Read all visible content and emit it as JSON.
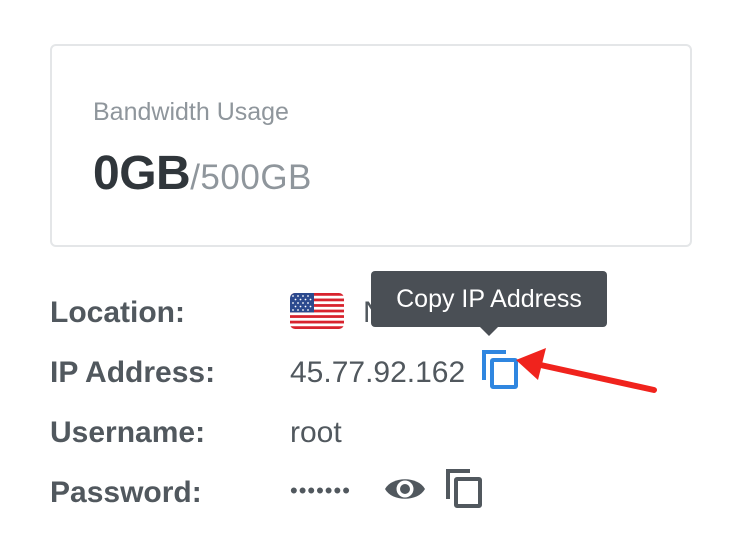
{
  "bandwidth": {
    "label": "Bandwidth Usage",
    "used": "0GB",
    "limit": "/500GB"
  },
  "details": {
    "location": {
      "label": "Location:",
      "value": "N",
      "flag_icon": "us-flag-icon"
    },
    "ip_address": {
      "label": "IP Address:",
      "value": "45.77.92.162",
      "copy_icon": "copy-icon"
    },
    "username": {
      "label": "Username:",
      "value": "root"
    },
    "password": {
      "label": "Password:",
      "value": "•••••••",
      "show_icon": "eye-icon",
      "copy_icon": "copy-icon"
    }
  },
  "tooltip": {
    "text": "Copy IP Address"
  },
  "colors": {
    "accent_blue": "#2f86e0",
    "tooltip_bg": "#4a4f55",
    "annotation_red": "#f0231d",
    "text_dark": "#51585e",
    "text_muted": "#8f969c"
  }
}
